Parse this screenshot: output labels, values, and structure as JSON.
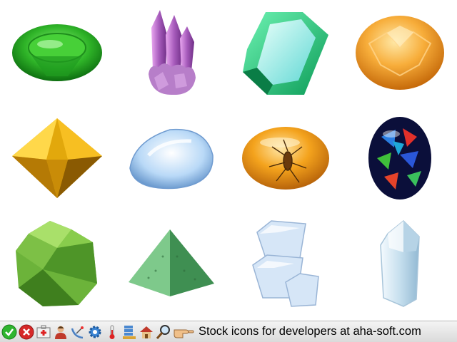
{
  "gallery": {
    "items": [
      {
        "icon": "green-emerald-oval-icon"
      },
      {
        "icon": "amethyst-crystal-cluster-icon"
      },
      {
        "icon": "emerald-cut-gem-icon"
      },
      {
        "icon": "orange-faceted-gem-icon"
      },
      {
        "icon": "yellow-octahedron-crystal-icon"
      },
      {
        "icon": "blue-water-drop-gem-icon"
      },
      {
        "icon": "amber-with-mosquito-icon"
      },
      {
        "icon": "black-opal-icon"
      },
      {
        "icon": "green-peridot-rock-icon"
      },
      {
        "icon": "jade-pyramid-icon"
      },
      {
        "icon": "ice-cubes-icon"
      },
      {
        "icon": "clear-quartz-crystal-icon"
      }
    ]
  },
  "footer": {
    "icons": [
      "check-icon",
      "cancel-icon",
      "first-aid-kit-icon",
      "user-icon",
      "satellite-dish-icon",
      "gear-icon",
      "thermometer-icon",
      "database-icon",
      "house-icon",
      "magnifier-icon",
      "pointing-hand-icon"
    ],
    "text": "Stock icons for developers at aha-soft.com"
  }
}
